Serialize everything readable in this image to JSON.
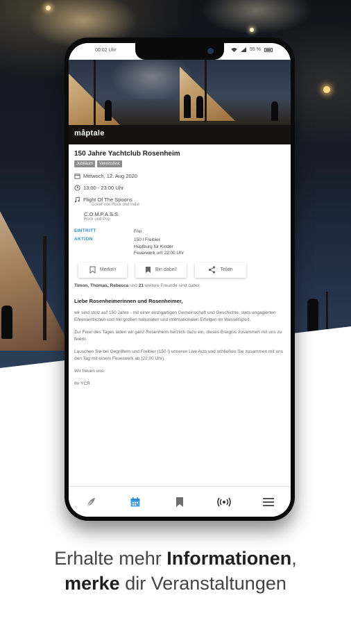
{
  "status_bar": {
    "time": "00:02 Uhr",
    "battery": "55 %"
  },
  "hero": {
    "brand": "måptale"
  },
  "event": {
    "title": "150 Jahre Yachtclub Rosenheim",
    "tags": [
      "Jubiläum",
      "Vereinsfest"
    ],
    "date": "Mittwoch, 12. Aug 2020",
    "time": "13:00 - 23:00 Uhr",
    "bands": [
      {
        "name": "Flight Of The Spoons",
        "desc": "Cover von Rock und Indie"
      },
      {
        "name": "C.O.M.P.A.S.S.",
        "desc": "Rock und Pop"
      }
    ],
    "info": {
      "eintritt_label": "EINTRITT",
      "eintritt_value": "Frei",
      "aktion_label": "AKTION",
      "aktion_lines": [
        "150 l Freibier",
        "Hüpfburg für Kinder",
        "Feuerwerk um 22:00 Uhr"
      ]
    },
    "actions": {
      "bookmark": "Merken",
      "attend": "Bin dabei!",
      "share": "Teilen"
    },
    "friends": {
      "names": "Timon, Thomas, Rebecca",
      "connector": " und ",
      "count": "21",
      "suffix": " weitere Freunde sind dabei."
    },
    "description": {
      "heading": "Liebe Rosenheimerinnen und Rosenheimer,",
      "paragraphs": [
        "wir sind stolz auf 150 Jahre - mit einer einzigartigen Gemeinschaft und Geschichte, stets engagierten Ehrenamtlichen und mit großen nationalen und internationalen Erfolgen im Wassersport.",
        "Zur Feier des Tages laden wir ganz Rosenheim herzlich dazu ein, dieses Ereignis zusammen mit uns zu feiern.",
        "Lauschen Sie bei Gegrilltem und Freibier (150 l) unseren Live Acts und schließen Sie zusammen mit uns den Tag mit einem Feuerwerk ab (22:00 Uhr).",
        "Wir freuen uns.",
        "Ihr YCR"
      ]
    }
  },
  "nav": [
    "feather-icon",
    "calendar-icon",
    "bookmark-icon",
    "broadcast-icon",
    "menu-icon"
  ],
  "colors": {
    "accent": "#2f8ed0",
    "nav_active": "#4aa3df"
  },
  "caption": {
    "line1_light": "Erhalte mehr ",
    "line1_bold": "Informationen",
    "line1_end": ",",
    "line2_bold": "merke",
    "line2_light": " dir Veranstaltungen"
  }
}
